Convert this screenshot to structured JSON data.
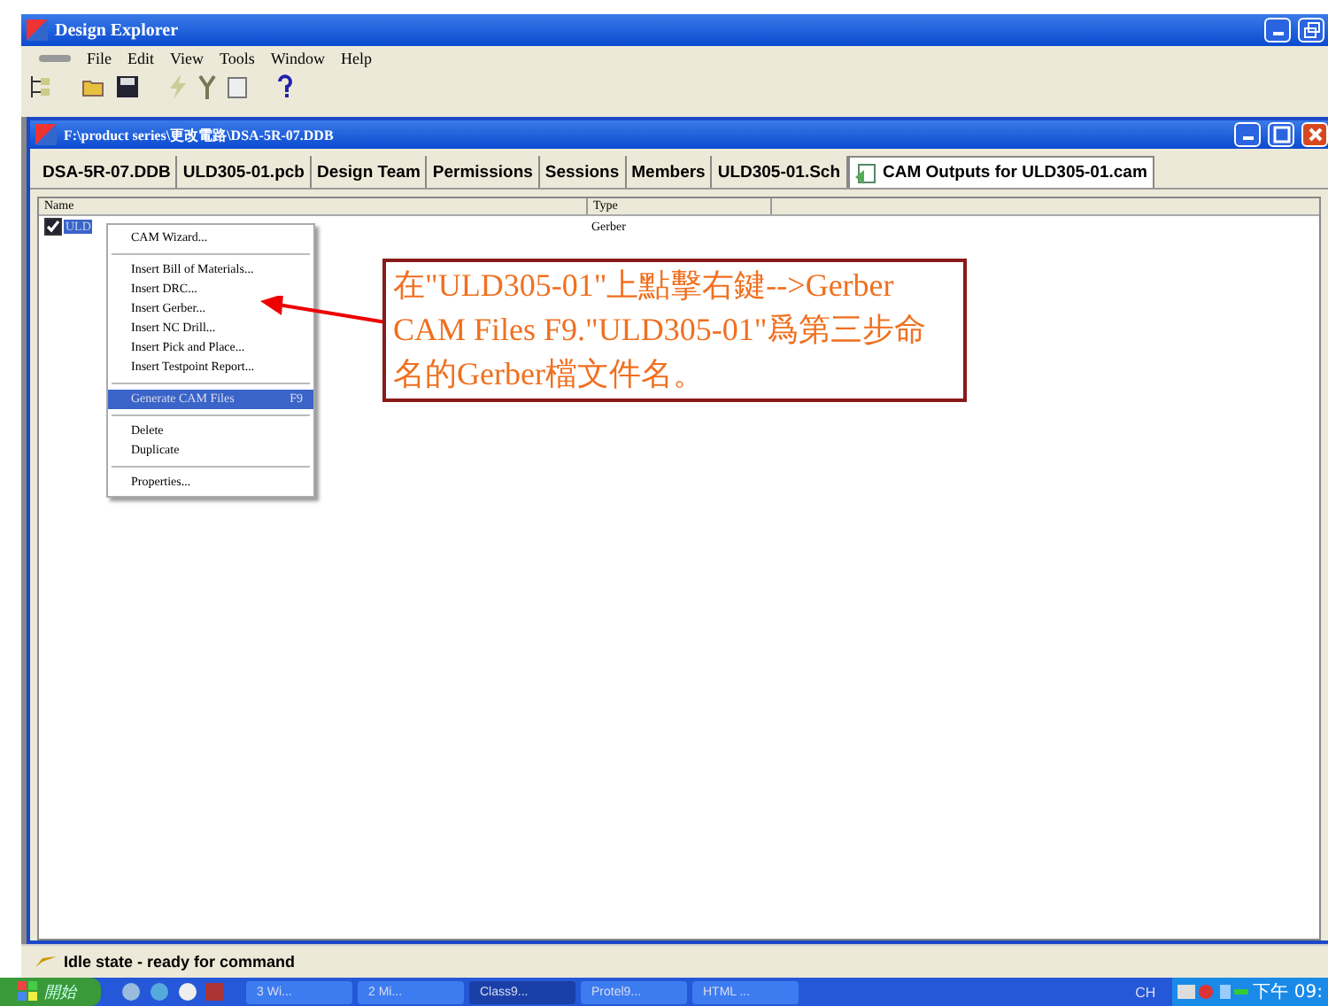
{
  "window": {
    "title": "Design Explorer"
  },
  "menu_bar": [
    "File",
    "Edit",
    "View",
    "Tools",
    "Window",
    "Help"
  ],
  "document": {
    "title": "F:\\product series\\更改電路\\DSA-5R-07.DDB"
  },
  "tabs": [
    {
      "label": "DSA-5R-07.DDB",
      "selected": false
    },
    {
      "label": "ULD305-01.pcb",
      "selected": false
    },
    {
      "label": "Design Team",
      "selected": false
    },
    {
      "label": "Permissions",
      "selected": false
    },
    {
      "label": "Sessions",
      "selected": false
    },
    {
      "label": "Members",
      "selected": false
    },
    {
      "label": "ULD305-01.Sch",
      "selected": false
    },
    {
      "label": "CAM Outputs for ULD305-01.cam",
      "selected": true
    }
  ],
  "table": {
    "columns": [
      "Name",
      "Type"
    ],
    "rows": [
      {
        "name": "ULD",
        "type": "Gerber",
        "checked": true,
        "selected": true
      }
    ]
  },
  "context_menu": [
    {
      "kind": "item",
      "label": "CAM Wizard...",
      "selected": false
    },
    {
      "kind": "separator"
    },
    {
      "kind": "item",
      "label": "Insert Bill of Materials...",
      "selected": false
    },
    {
      "kind": "item",
      "label": "Insert DRC...",
      "selected": false
    },
    {
      "kind": "item",
      "label": "Insert Gerber...",
      "selected": false
    },
    {
      "kind": "item",
      "label": "Insert NC Drill...",
      "selected": false
    },
    {
      "kind": "item",
      "label": "Insert Pick and Place...",
      "selected": false
    },
    {
      "kind": "item",
      "label": "Insert Testpoint Report...",
      "selected": false
    },
    {
      "kind": "separator"
    },
    {
      "kind": "item",
      "label": "Generate CAM Files",
      "shortcut": "F9",
      "selected": true
    },
    {
      "kind": "separator"
    },
    {
      "kind": "item",
      "label": "Delete",
      "selected": false
    },
    {
      "kind": "item",
      "label": "Duplicate",
      "selected": false
    },
    {
      "kind": "separator"
    },
    {
      "kind": "item",
      "label": "Properties...",
      "selected": false
    }
  ],
  "callout": {
    "text": "在\"ULD305-01\"上點擊右鍵-->Gerber CAM Files F9.\"ULD305-01\"爲第三步命名的Gerber檔文件名。"
  },
  "status_bar": "Idle state - ready for command",
  "taskbar": {
    "start": "開始",
    "buttons": [
      {
        "label": "3 Wi...",
        "selected": false
      },
      {
        "label": "2 Mi...",
        "selected": false
      },
      {
        "label": "Class9...",
        "selected": true
      },
      {
        "label": "Protel9...",
        "selected": false
      },
      {
        "label": "HTML ...",
        "selected": false
      }
    ],
    "language": "CH",
    "clock": "下午 09:"
  }
}
